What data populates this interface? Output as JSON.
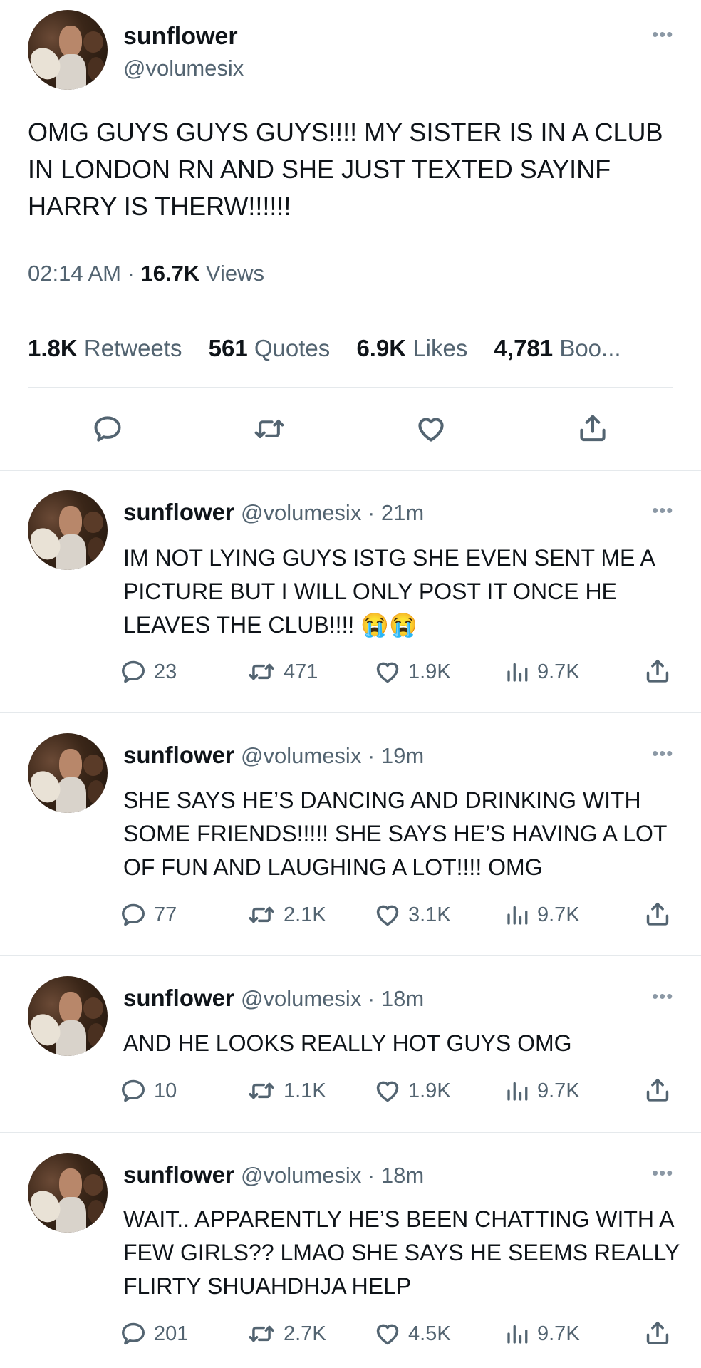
{
  "main_tweet": {
    "name": "sunflower",
    "handle": "@volumesix",
    "text": "OMG GUYS GUYS GUYS!!!! MY SISTER IS IN A CLUB IN LONDON RN AND SHE JUST TEXTED SAYINF HARRY IS THERW!!!!!!",
    "time": "02:14 AM",
    "separator": "·",
    "views_count": "16.7K",
    "views_label": "Views",
    "stats": [
      {
        "num": "1.8K",
        "label": "Retweets"
      },
      {
        "num": "561",
        "label": "Quotes"
      },
      {
        "num": "6.9K",
        "label": "Likes"
      },
      {
        "num": "4,781",
        "label": "Boo..."
      }
    ],
    "actions": [
      "reply-icon",
      "retweet-icon",
      "like-icon",
      "share-icon"
    ]
  },
  "replies": [
    {
      "name": "sunflower",
      "meta": "@volumesix · 21m",
      "text": "IM NOT LYING GUYS ISTG SHE EVEN SENT ME A PICTURE BUT I WILL ONLY POST IT ONCE HE LEAVES THE CLUB!!!! 😭😭",
      "replies": "23",
      "retweets": "471",
      "likes": "1.9K",
      "views": "9.7K"
    },
    {
      "name": "sunflower",
      "meta": "@volumesix · 19m",
      "text": "SHE SAYS HE’S DANCING AND DRINKING WITH SOME FRIENDS!!!!! SHE SAYS HE’S HAVING A LOT OF FUN AND LAUGHING A LOT!!!! OMG",
      "replies": "77",
      "retweets": "2.1K",
      "likes": "3.1K",
      "views": "9.7K"
    },
    {
      "name": "sunflower",
      "meta": "@volumesix · 18m",
      "text": "AND HE LOOKS REALLY HOT GUYS OMG",
      "replies": "10",
      "retweets": "1.1K",
      "likes": "1.9K",
      "views": "9.7K"
    },
    {
      "name": "sunflower",
      "meta": "@volumesix · 18m",
      "text": "WAIT.. APPARENTLY HE’S BEEN CHATTING WITH A FEW GIRLS?? LMAO SHE SAYS HE SEEMS REALLY FLIRTY SHUAHDHJA HELP",
      "replies": "201",
      "retweets": "2.7K",
      "likes": "4.5K",
      "views": "9.7K"
    }
  ],
  "colors": {
    "text": "#0f1419",
    "secondary": "#536471",
    "divider": "#e5e9ec",
    "more": "#8b98a5"
  }
}
